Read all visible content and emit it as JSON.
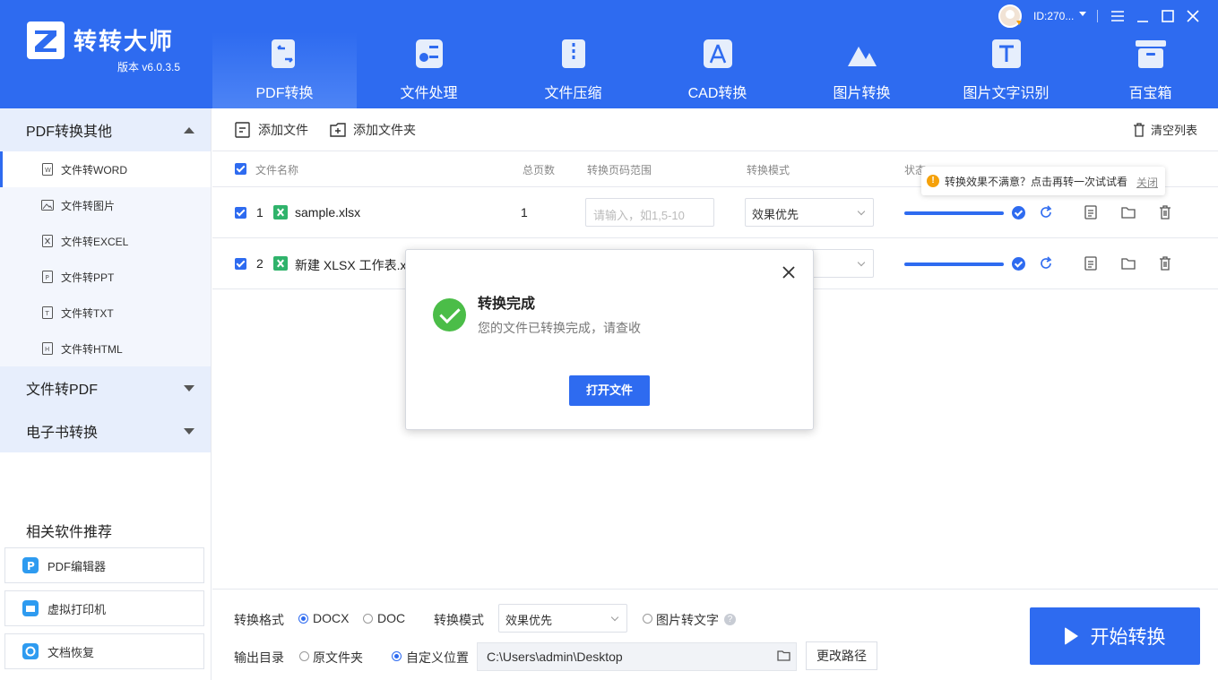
{
  "app": {
    "title": "转转大师",
    "version": "版本 v6.0.3.5",
    "user_id": "ID:270..."
  },
  "nav": {
    "tabs": [
      {
        "label": "PDF转换",
        "icon": "pdf-convert-icon",
        "active": true
      },
      {
        "label": "文件处理",
        "icon": "file-process-icon"
      },
      {
        "label": "文件压缩",
        "icon": "zip-icon"
      },
      {
        "label": "CAD转换",
        "icon": "cad-icon"
      },
      {
        "label": "图片转换",
        "icon": "image-icon"
      },
      {
        "label": "图片文字识别",
        "icon": "ocr-icon"
      },
      {
        "label": "百宝箱",
        "icon": "toolbox-icon"
      }
    ]
  },
  "sidebar": {
    "group1": "PDF转换其他",
    "items": [
      {
        "label": "文件转WORD",
        "active": true
      },
      {
        "label": "文件转图片"
      },
      {
        "label": "文件转EXCEL"
      },
      {
        "label": "文件转PPT"
      },
      {
        "label": "文件转TXT"
      },
      {
        "label": "文件转HTML"
      }
    ],
    "group2": "文件转PDF",
    "group3": "电子书转换",
    "recommend_title": "相关软件推荐",
    "recommend": [
      {
        "label": "PDF编辑器",
        "icon": "pdf-editor-icon"
      },
      {
        "label": "虚拟打印机",
        "icon": "printer-icon"
      },
      {
        "label": "文档恢复",
        "icon": "recovery-icon"
      }
    ]
  },
  "toolbar": {
    "add_file": "添加文件",
    "add_folder": "添加文件夹",
    "clear_list": "清空列表"
  },
  "table": {
    "headers": {
      "name": "文件名称",
      "pages": "总页数",
      "range": "转换页码范围",
      "mode": "转换模式",
      "status": "状态"
    },
    "rows": [
      {
        "index": "1",
        "name": "sample.xlsx",
        "pages": "1",
        "range_placeholder": "请输入，如1,5-10",
        "mode": "效果优先",
        "progress": 1.0
      },
      {
        "index": "2",
        "name": "新建 XLSX 工作表.xl",
        "pages": "",
        "mode": "",
        "progress": 1.0
      }
    ]
  },
  "tooltip": {
    "text": "转换效果不满意？点击再转一次试试看",
    "close": "关闭"
  },
  "modal": {
    "title": "转换完成",
    "message": "您的文件已转换完成，请查收",
    "open_button": "打开文件"
  },
  "bottom": {
    "format_label": "转换格式",
    "format_options": [
      "DOCX",
      "DOC"
    ],
    "format_selected": "DOCX",
    "mode_label": "转换模式",
    "mode_value": "效果优先",
    "ocr_label": "图片转文字",
    "output_label": "输出目录",
    "output_original": "原文件夹",
    "output_custom": "自定义位置",
    "output_path": "C:\\Users\\admin\\Desktop",
    "change_path": "更改路径",
    "start": "开始转换"
  },
  "colors": {
    "brand": "#2e6bf0",
    "success": "#4bbd48",
    "warning": "#f5a10a",
    "excel": "#2fb36b"
  }
}
